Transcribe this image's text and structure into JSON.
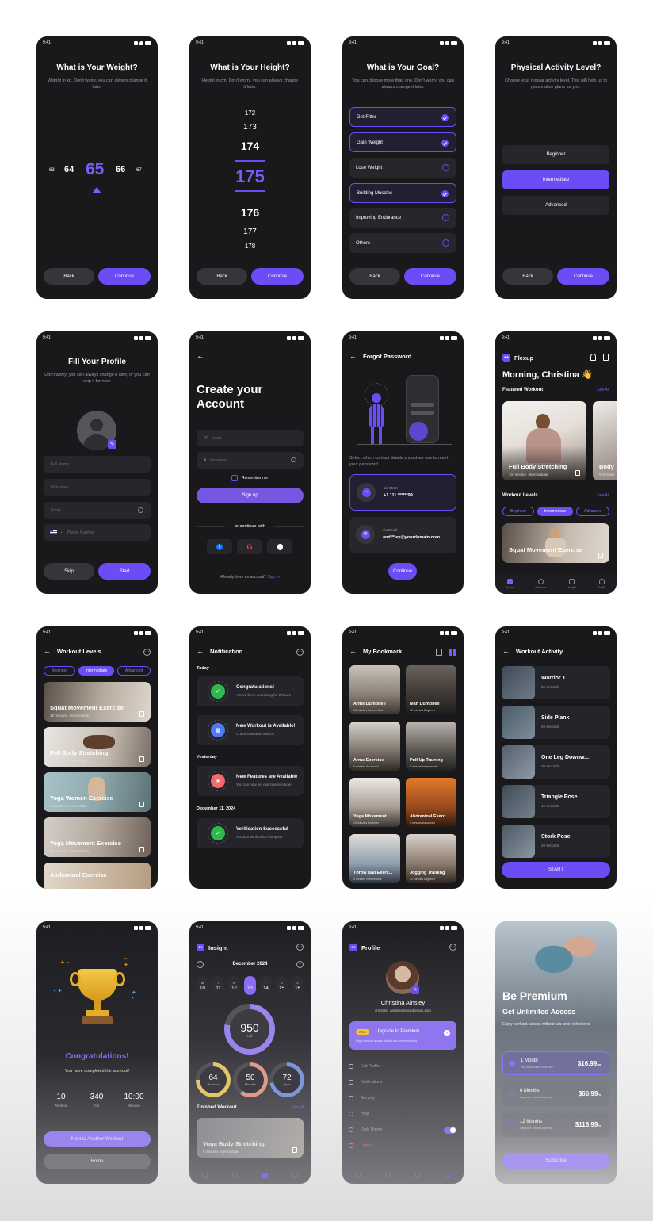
{
  "status_time": "9:41",
  "weight": {
    "title": "What is Your Weight?",
    "subtitle": "Weight in kg. Don't worry, you can always change it later.",
    "values": [
      "63",
      "64",
      "65",
      "66",
      "67"
    ],
    "back": "Back",
    "continue": "Continue"
  },
  "height": {
    "title": "What is Your Height?",
    "subtitle": "Height in cm. Don't worry, you can always change it later.",
    "values": [
      "172",
      "173",
      "174",
      "175",
      "176",
      "177",
      "178"
    ],
    "back": "Back",
    "continue": "Continue"
  },
  "goal": {
    "title": "What is Your Goal?",
    "subtitle": "You can choose more than one. Don't worry, you can always change it later.",
    "options": [
      {
        "label": "Get Fitter",
        "selected": true
      },
      {
        "label": "Gain Weight",
        "selected": true
      },
      {
        "label": "Lose Weight",
        "selected": false
      },
      {
        "label": "Building Muscles",
        "selected": true
      },
      {
        "label": "Improving Endurance",
        "selected": false
      },
      {
        "label": "Others",
        "selected": false
      }
    ],
    "back": "Back",
    "continue": "Continue"
  },
  "activity": {
    "title": "Physical Activity Level?",
    "subtitle": "Choose your regular activity level. This will help us to personalize plans for you.",
    "levels": [
      "Beginner",
      "Intermediate",
      "Advanced"
    ],
    "back": "Back",
    "continue": "Continue"
  },
  "profile_form": {
    "title": "Fill Your Profile",
    "subtitle": "Don't worry, you can always change it later, or you can skip it for now.",
    "fields": [
      "Full Name",
      "Nickname",
      "Email",
      "Phone Number"
    ],
    "phone_code": "+",
    "skip": "Skip",
    "start": "Start"
  },
  "signup": {
    "title_line1": "Create your",
    "title_line2": "Account",
    "email": "Email",
    "password": "Password",
    "remember": "Remember me",
    "signup": "Sign up",
    "or": "or continue with",
    "already": "Already have an account?",
    "signin": "Sign in"
  },
  "forgot": {
    "title": "Forgot Password",
    "desc": "Select which contact details should we use to reset your password",
    "sms_label": "via SMS:",
    "sms_value": "+1 111 ******99",
    "email_label": "via Email:",
    "email_value": "and***ey@yourdomain.com",
    "continue": "Continue"
  },
  "home": {
    "brand": "Flexup",
    "greeting": "Morning, Christina 👋",
    "featured": "Featured Workout",
    "see_all": "See All",
    "feat_cards": [
      {
        "title": "Full Body Stretching",
        "duration": "10 minutes",
        "level": "Intermediate"
      },
      {
        "title": "Body",
        "duration": "9 minutes",
        "level": ""
      }
    ],
    "levels_title": "Workout Levels",
    "levels_see_all": "See All",
    "levels": [
      "Beginner",
      "Intermediate",
      "Advanced"
    ],
    "level_card": "Squat Movement Exercise",
    "nav": [
      "Home",
      "Discover",
      "Insight",
      "Profile"
    ]
  },
  "workout_levels": {
    "title": "Workout Levels",
    "tabs": [
      "Beginner",
      "Intermediate",
      "Advanced"
    ],
    "cards": [
      {
        "title": "Squat Movement Exercise",
        "duration": "12 minutes",
        "level": "Intermediate"
      },
      {
        "title": "Full Body Stretching",
        "duration": "6 minutes",
        "level": "Intermediate"
      },
      {
        "title": "Yoga Women Exercise",
        "duration": "8 minutes",
        "level": "Intermediate"
      },
      {
        "title": "Yoga Movement Exercise",
        "duration": "10 minutes",
        "level": "Intermediate"
      },
      {
        "title": "Abdominal Exercise",
        "duration": "",
        "level": ""
      }
    ]
  },
  "notification": {
    "title": "Notification",
    "groups": [
      {
        "date": "Today",
        "items": [
          {
            "title": "Congratulations!",
            "desc": "You've been exercising for 2 hours",
            "color": "#2fb84b"
          },
          {
            "title": "New Workout is Available!",
            "desc": "Check now and practice",
            "color": "#4d7cf2"
          }
        ]
      },
      {
        "date": "Yesterday",
        "items": [
          {
            "title": "New Features are Available",
            "desc": "You can now set exercise reminder",
            "color": "#f26a6a"
          }
        ]
      },
      {
        "date": "December 11, 2024",
        "items": [
          {
            "title": "Verification Successful",
            "desc": "Account verification complete",
            "color": "#2fb84b"
          }
        ]
      }
    ]
  },
  "bookmark": {
    "title": "My Bookmark",
    "items": [
      {
        "title": "Arms Dumbbell",
        "duration": "12 minutes",
        "level": "Intermediate"
      },
      {
        "title": "Man Dumbbell",
        "duration": "10 minutes",
        "level": "Beginner"
      },
      {
        "title": "Arms Exercise",
        "duration": "6 minutes",
        "level": "Advanced"
      },
      {
        "title": "Pull Up Training",
        "duration": "8 minutes",
        "level": "Intermediate"
      },
      {
        "title": "Yoga Movement",
        "duration": "10 minutes",
        "level": "Beginner"
      },
      {
        "title": "Abdominal Exerc...",
        "duration": "6 minutes",
        "level": "Advanced"
      },
      {
        "title": "Throw Ball Exerc...",
        "duration": "8 minutes",
        "level": "Intermediate"
      },
      {
        "title": "Jogging Training",
        "duration": "12 minutes",
        "level": "Beginner"
      }
    ]
  },
  "activity_list": {
    "title": "Workout Activity",
    "items": [
      {
        "name": "Warrior 1",
        "dur": "30 seconds"
      },
      {
        "name": "Side Plank",
        "dur": "20 seconds"
      },
      {
        "name": "One Leg Downw...",
        "dur": "20 seconds"
      },
      {
        "name": "Triangle Pose",
        "dur": "40 seconds"
      },
      {
        "name": "Stork Pose",
        "dur": "20 seconds"
      }
    ],
    "start": "START"
  },
  "congrats": {
    "title": "Congratulations!",
    "subtitle": "You have completed the workout!",
    "stats": [
      {
        "value": "10",
        "label": "Workout"
      },
      {
        "value": "340",
        "label": "Cal"
      },
      {
        "value": "10:00",
        "label": "Minutes"
      }
    ],
    "next": "Next to Another Workout",
    "home": "Home"
  },
  "insight": {
    "title": "Insight",
    "month": "December 2024",
    "days": [
      {
        "d": "M",
        "n": "10"
      },
      {
        "d": "T",
        "n": "11"
      },
      {
        "d": "W",
        "n": "12"
      },
      {
        "d": "T",
        "n": "13"
      },
      {
        "d": "F",
        "n": "14"
      },
      {
        "d": "S",
        "n": "15"
      },
      {
        "d": "S",
        "n": "16"
      }
    ],
    "selected_day": 3,
    "cal_value": "950",
    "cal_label": "Cal",
    "cal_fraction": 0.78,
    "small": [
      {
        "value": "64",
        "label": "Workout",
        "color": "#e3c766",
        "fraction": 0.75
      },
      {
        "value": "50",
        "label": "Minutes",
        "color": "#e09a86",
        "fraction": 0.6
      },
      {
        "value": "72",
        "label": "Bpm",
        "color": "#7b96d9",
        "fraction": 0.72
      }
    ],
    "finished": "Finished Workout",
    "see_all": "See All",
    "card": "Yoga Body Stretching",
    "card_meta": "8 minutes  Intermediate"
  },
  "profile": {
    "title": "Profile",
    "name": "Christina Ainsley",
    "email": "christina_ainsley@yourdomain.com",
    "pro": "PRO",
    "upgrade": "Upgrade to Premium",
    "upgrade_desc": "Enjoy workout access without ads and restrictions",
    "menu": [
      "Edit Profile",
      "Notifications",
      "Security",
      "Help",
      "Dark Theme",
      "Logout"
    ]
  },
  "premium": {
    "title": "Be Premium",
    "subtitle": "Get Unlimited Access",
    "desc": "Enjoy workout access without ads and restrictions",
    "plans": [
      {
        "name": "1 Month",
        "desc": "Pay once, cancel any time",
        "price": "$16.99",
        "per": "/m"
      },
      {
        "name": "6 Months",
        "desc": "Pay once, cancel any time",
        "price": "$66.99",
        "per": "/m"
      },
      {
        "name": "12 Months",
        "desc": "Pay once, cancel any time",
        "price": "$116.99",
        "per": "/m"
      }
    ],
    "subscribe": "Subscribe"
  },
  "colors": {
    "accent": "#6c4cf5",
    "bg": "#19191c",
    "card": "#26262b"
  }
}
